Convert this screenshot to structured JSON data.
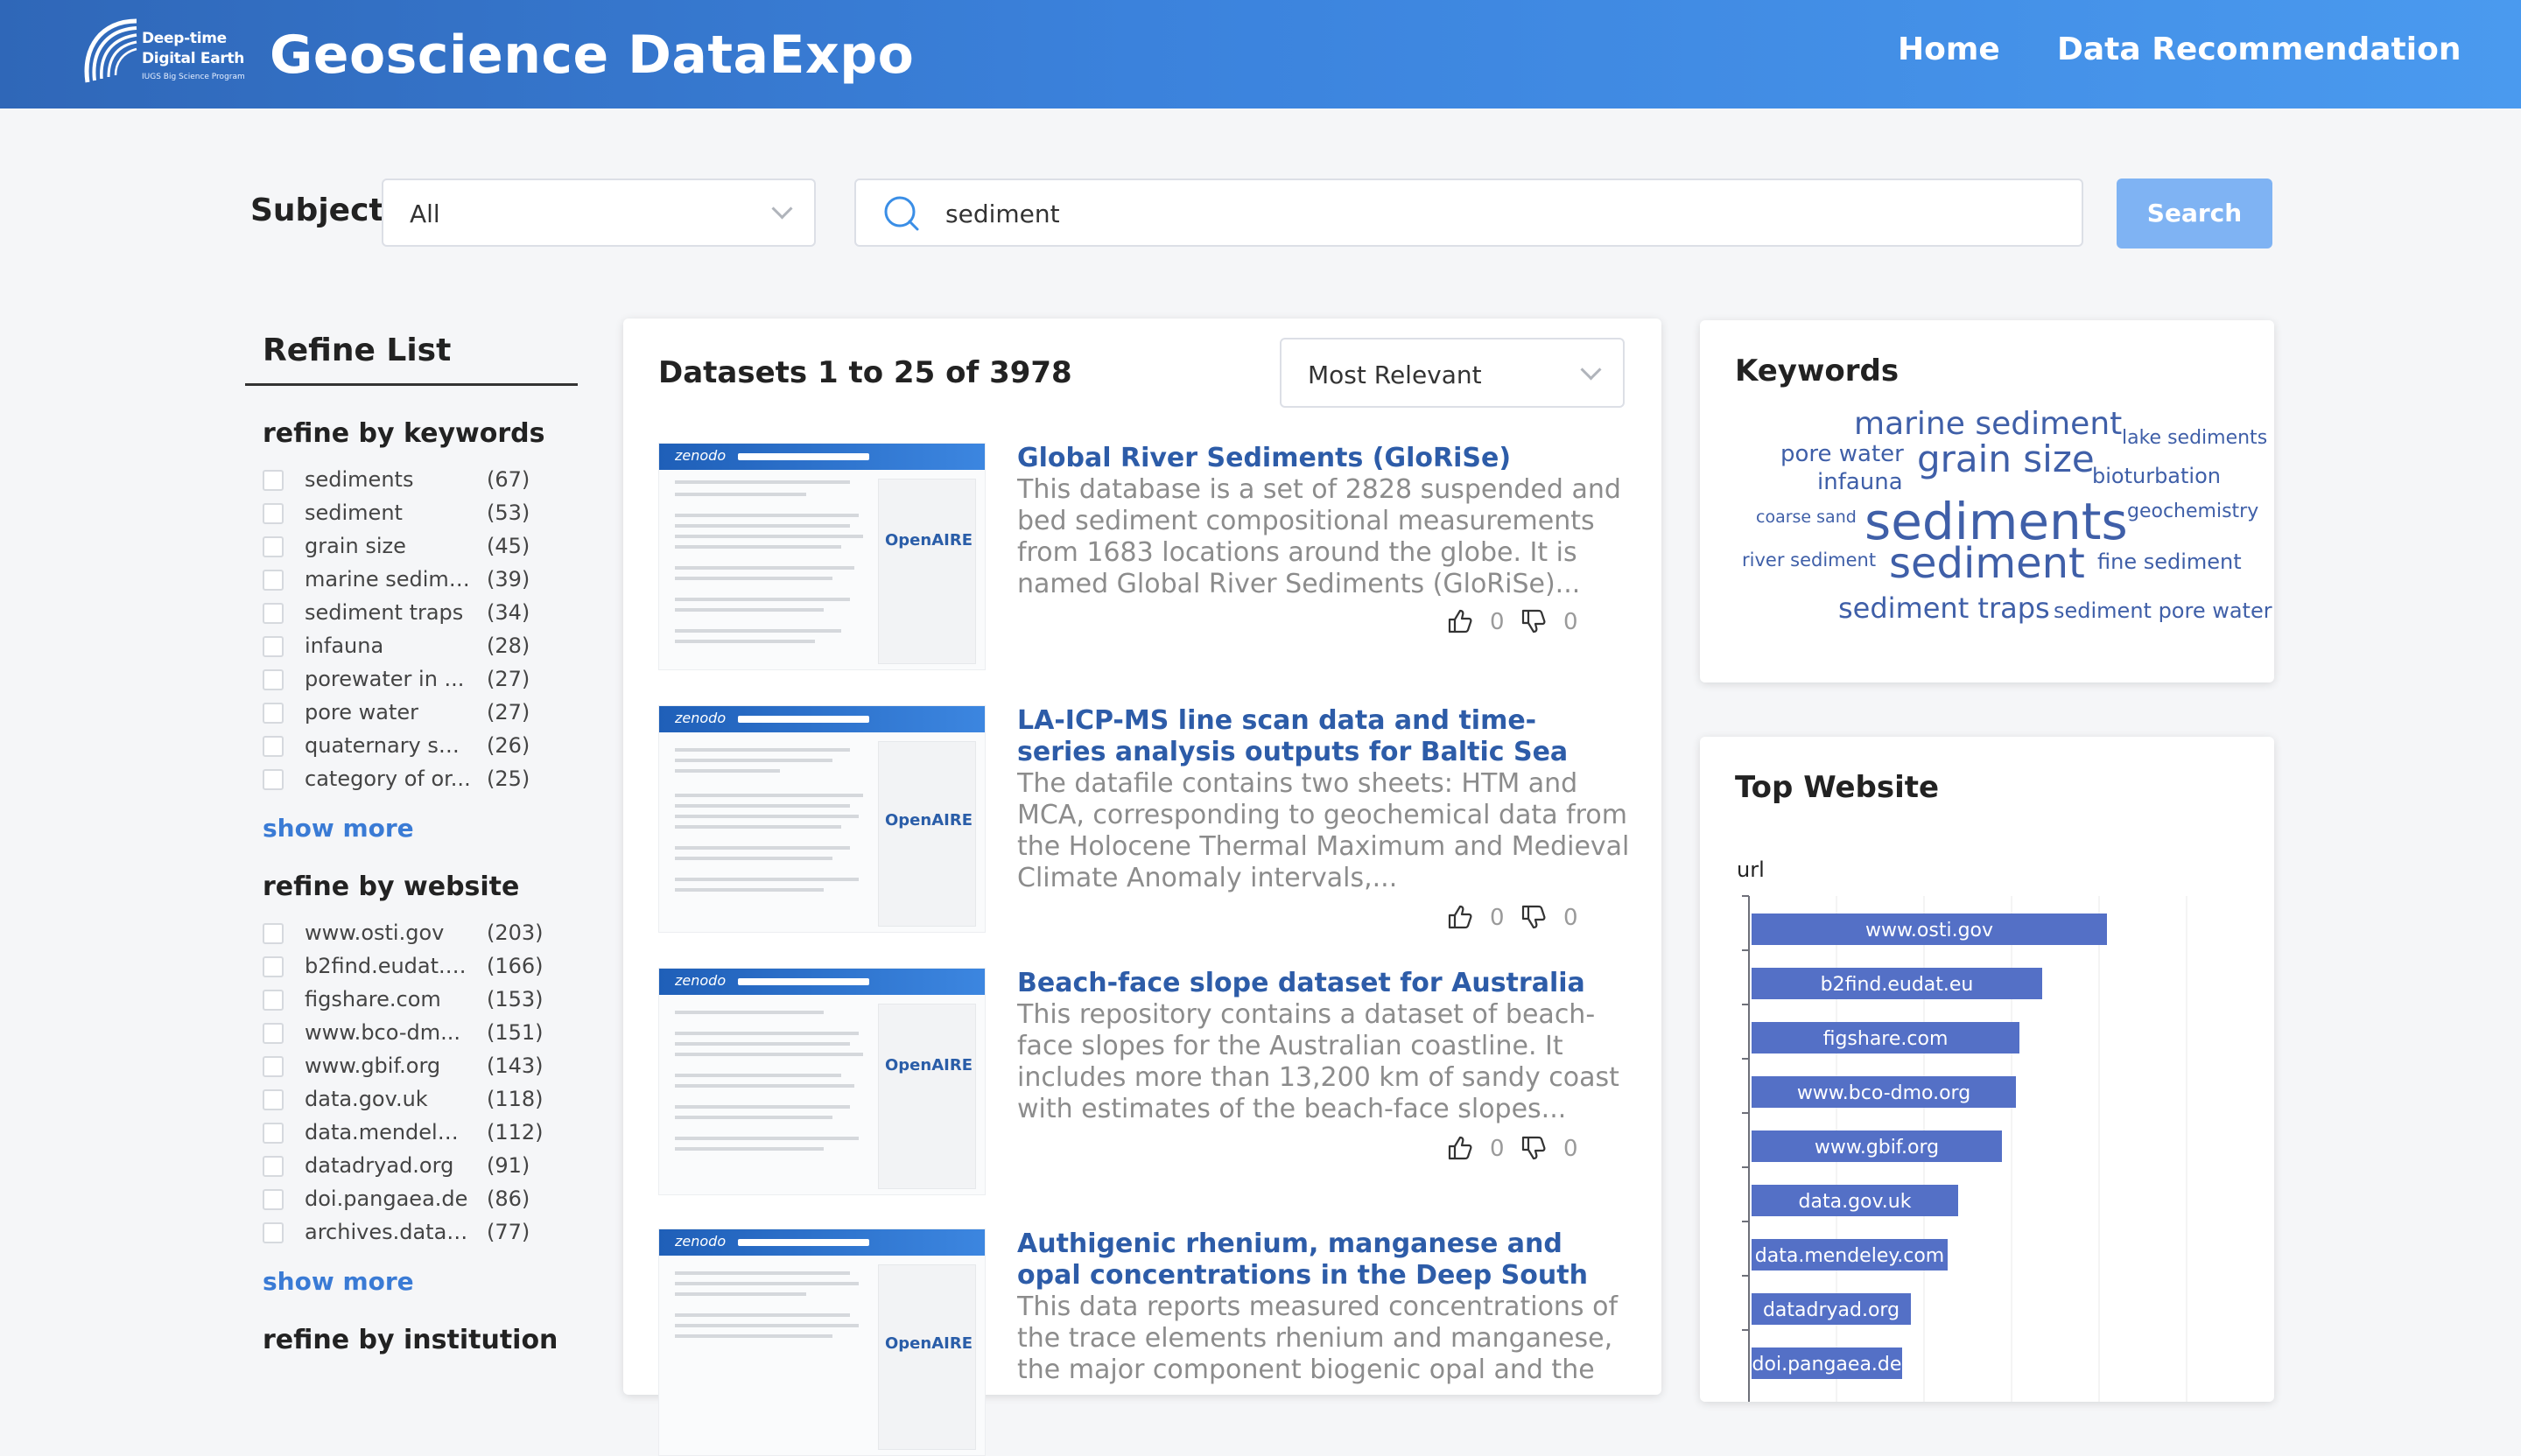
{
  "header": {
    "logo_line1": "Deep-time",
    "logo_line2": "Digital Earth",
    "logo_line3": "IUGS Big Science Program",
    "brand": "Geoscience DataExpo",
    "nav": [
      "Home",
      "Data Recommendation"
    ]
  },
  "search": {
    "subject_label": "Subject",
    "subject_value": "All",
    "query": "sediment",
    "button": "Search"
  },
  "refine": {
    "title": "Refine List",
    "keywords_title": "refine by keywords",
    "keywords": [
      {
        "name": "sediments",
        "count": "(67)"
      },
      {
        "name": "sediment",
        "count": "(53)"
      },
      {
        "name": "grain size",
        "count": "(45)"
      },
      {
        "name": "marine sedime...",
        "count": "(39)"
      },
      {
        "name": "sediment traps",
        "count": "(34)"
      },
      {
        "name": "infauna",
        "count": "(28)"
      },
      {
        "name": "porewater in ...",
        "count": "(27)"
      },
      {
        "name": "pore water",
        "count": "(27)"
      },
      {
        "name": "quaternary sed...",
        "count": "(26)"
      },
      {
        "name": "category of or...",
        "count": "(25)"
      }
    ],
    "show_more": "show more",
    "website_title": "refine by website",
    "websites": [
      {
        "name": "www.osti.gov",
        "count": "(203)"
      },
      {
        "name": "b2find.eudat.eu",
        "count": "(166)"
      },
      {
        "name": "figshare.com",
        "count": "(153)"
      },
      {
        "name": "www.bco-dm...",
        "count": "(151)"
      },
      {
        "name": "www.gbif.org",
        "count": "(143)"
      },
      {
        "name": "data.gov.uk",
        "count": "(118)"
      },
      {
        "name": "data.mendeley...",
        "count": "(112)"
      },
      {
        "name": "datadryad.org",
        "count": "(91)"
      },
      {
        "name": "doi.pangaea.de",
        "count": "(86)"
      },
      {
        "name": "archives.datap...",
        "count": "(77)"
      }
    ],
    "institution_title": "refine by institution"
  },
  "datasets": {
    "header": "Datasets 1 to 25 of 3978",
    "sort": "Most Relevant",
    "results": [
      {
        "title": "Global River Sediments (GloRiSe)",
        "desc": "This database is a set of 2828 suspended and bed sediment compositional measurements from 1683 locations around the globe. It is named Global River Sediments (GloRiSe)...",
        "up": "0",
        "down": "0"
      },
      {
        "title": "LA-ICP-MS line scan data and time-series analysis outputs for Baltic Sea sediment cor...",
        "desc": "The datafile contains two sheets: HTM and MCA, corresponding to geochemical data from the Holocene Thermal Maximum and Medieval Climate Anomaly intervals,...",
        "up": "0",
        "down": "0"
      },
      {
        "title": "Beach-face slope dataset for Australia",
        "desc": "This repository contains a dataset of beach-face slopes for the Australian coastline. It includes more than 13,200 km of sandy coast with estimates of the beach-face slopes...",
        "up": "0",
        "down": "0"
      },
      {
        "title": "Authigenic rhenium, manganese and opal concentrations in the Deep South Atlantic...",
        "desc": "This data reports measured concentrations of the trace elements rhenium and manganese, the major component biogenic opal and the",
        "up": "0",
        "down": "0"
      }
    ]
  },
  "keywords_panel": {
    "title": "Keywords",
    "words": [
      "marine sediment",
      "lake sediments",
      "pore water",
      "grain size",
      "bioturbation",
      "infauna",
      "coarse sand",
      "sediments",
      "geochemistry",
      "river sediment",
      "sediment",
      "fine sediment",
      "sediment traps",
      "sediment pore water"
    ]
  },
  "top_website": {
    "title": "Top Website",
    "axis_label": "url",
    "bar_color": "#5470c6"
  },
  "chart_data": {
    "type": "bar",
    "orientation": "horizontal",
    "ylabel": "url",
    "categories": [
      "www.osti.gov",
      "b2find.eudat.eu",
      "figshare.com",
      "www.bco-dmo.org",
      "www.gbif.org",
      "data.gov.uk",
      "data.mendeley.com",
      "datadryad.org",
      "doi.pangaea.de"
    ],
    "values": [
      203,
      166,
      153,
      151,
      143,
      118,
      112,
      91,
      86
    ],
    "xlim": [
      0,
      250
    ],
    "grid": true
  }
}
